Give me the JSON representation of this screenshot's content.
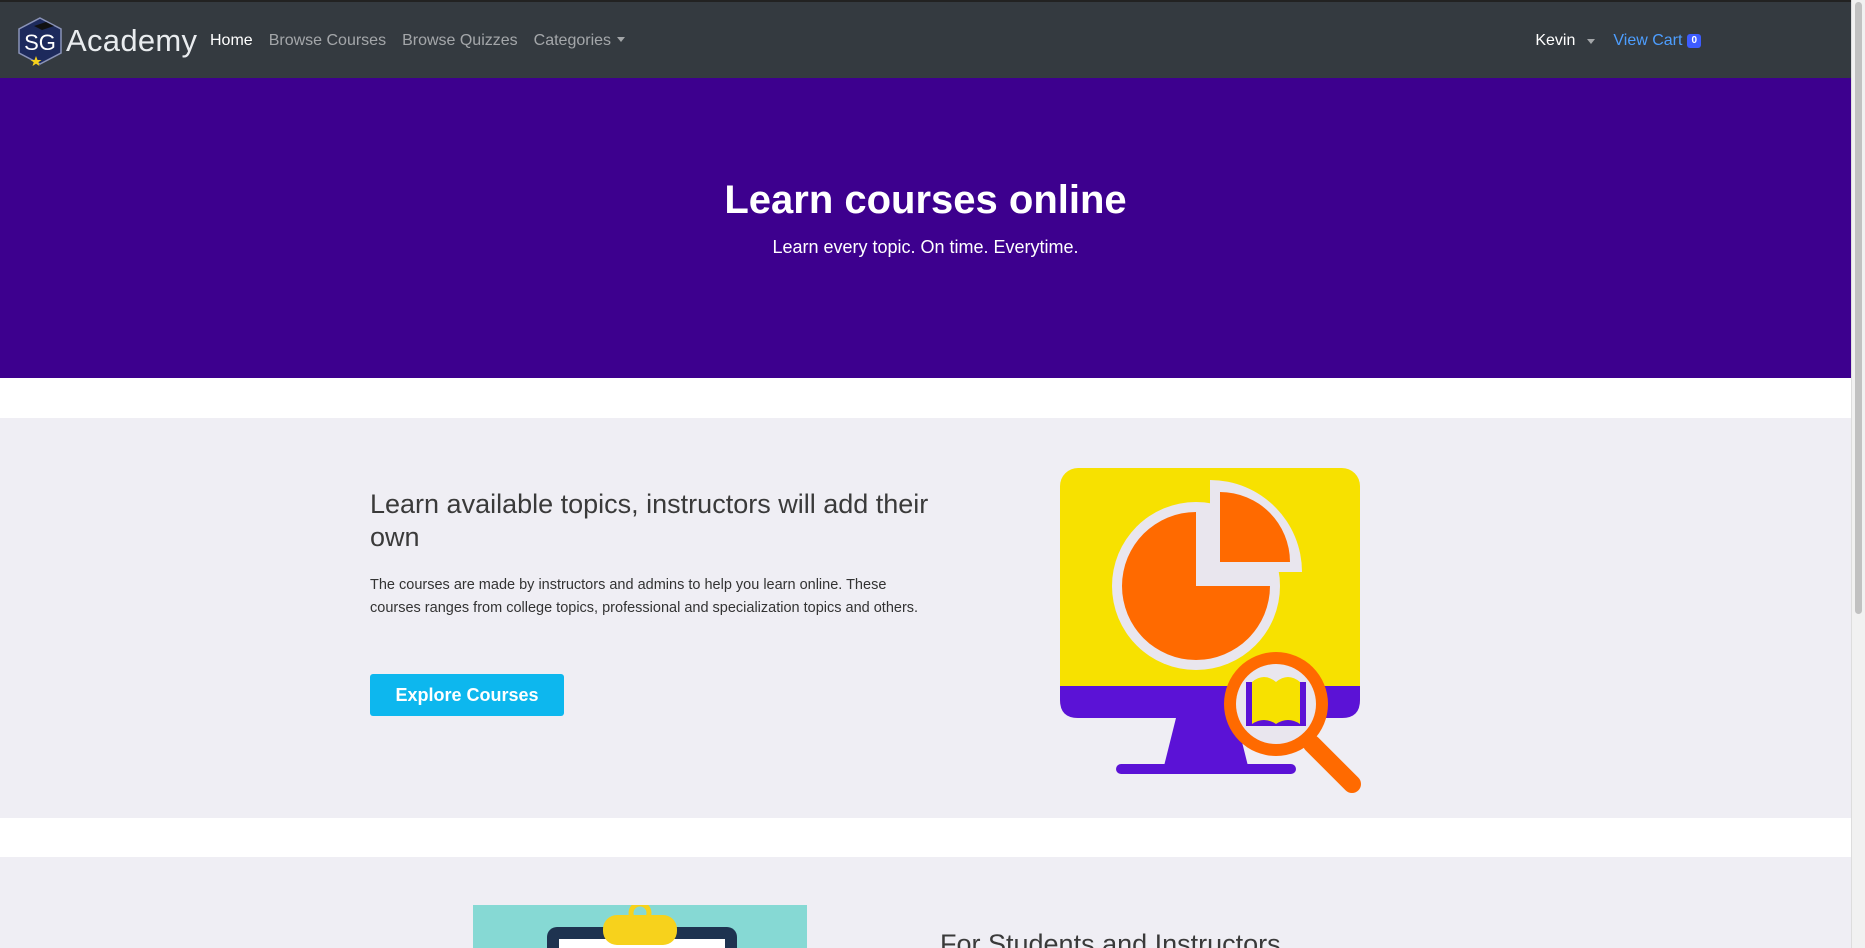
{
  "navbar": {
    "brand_logo_text": "SG",
    "brand_text": "Academy",
    "links": [
      {
        "label": "Home"
      },
      {
        "label": "Browse Courses"
      },
      {
        "label": "Browse Quizzes"
      },
      {
        "label": "Categories"
      }
    ],
    "user_name": "Kevin",
    "cart_label": "View Cart",
    "cart_count": "0"
  },
  "hero": {
    "title": "Learn courses online",
    "subtitle": "Learn every topic. On time. Everytime."
  },
  "section1": {
    "heading": "Learn available topics, instructors will add their own",
    "text": "The courses are made by instructors and admins to help you learn online. These courses ranges from college topics, professional and specialization topics and others.",
    "button_label": "Explore Courses"
  },
  "section2": {
    "heading": "For Students and Instructors"
  },
  "colors": {
    "navbar_bg": "#343a40",
    "hero_bg": "#3d008e",
    "section_bg": "#efeef4",
    "button_bg": "#0db7ee",
    "cart_link": "#4d9eff"
  }
}
